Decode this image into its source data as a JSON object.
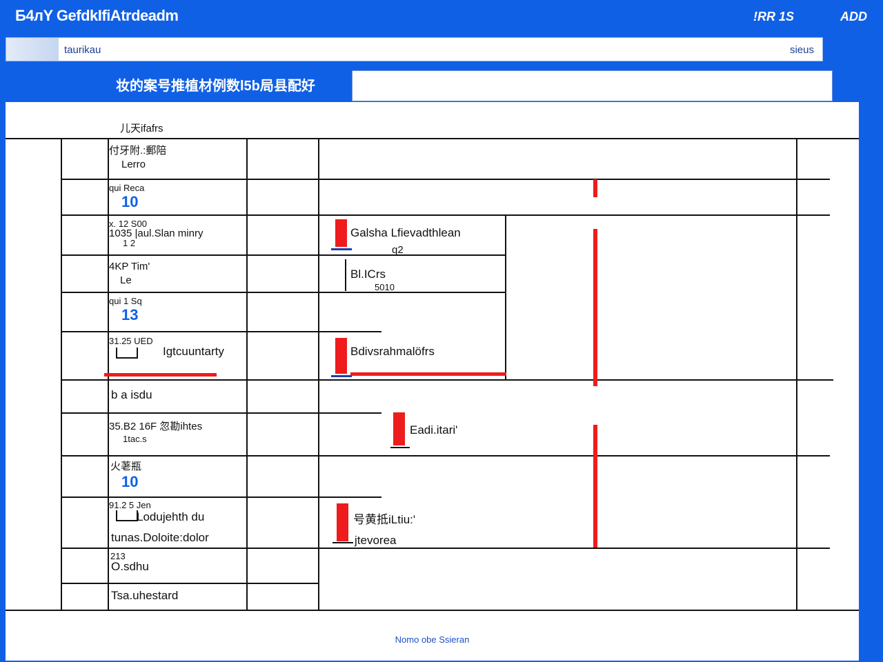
{
  "header": {
    "title": "Б4лY GefdkIfiAtrdeadm",
    "right1": "!RR 1S",
    "right2": "ADD"
  },
  "search": {
    "value": "taurikau",
    "right": "sieus"
  },
  "section": {
    "title": "妆的案号推植材例数l5b局县配好"
  },
  "table": {
    "header": "儿天ifafrs",
    "rows": [
      {
        "a": "付牙附.:郵陪",
        "b": "Lerro"
      },
      {
        "a": "qui Reca",
        "num": "10"
      },
      {
        "a": "x. 12 S00",
        "b": "1035 |aul.Slan minry",
        "c": "1 2"
      },
      {
        "a": "4KP Tim'",
        "b": "Le"
      },
      {
        "a": "qui 1 Sq",
        "num": "13"
      },
      {
        "a": "31.25 UED",
        "b": "Igtcuuntarty"
      },
      {
        "a": "b a isdu"
      },
      {
        "a": "35.B2 16F 忽勘ihtes",
        "b": "1tac.s"
      },
      {
        "a": "火荖瓶",
        "num": "10"
      },
      {
        "a": "91.2 5 Jen",
        "b": "Lodujehth du",
        "c": "tunas.Doloite:dolor"
      },
      {
        "a": "213",
        "b": "O.sdhu"
      },
      {
        "a": "Tsa.uhestard"
      }
    ]
  },
  "events": [
    {
      "title": "Galsha Lfievadthlean",
      "sub": "q2"
    },
    {
      "title": "Bl.ICrs",
      "sub": "5010"
    },
    {
      "title": "Bdivsrahmalöfrs"
    },
    {
      "title": "Eadi.itari'"
    },
    {
      "title": "号黄抵iLtiu:'",
      "sub": "jtevorea"
    }
  ],
  "footer": {
    "text": "Nomo obe Ssieran"
  },
  "colors": {
    "accent": "#1060e6",
    "marker": "#ee1c1c"
  }
}
